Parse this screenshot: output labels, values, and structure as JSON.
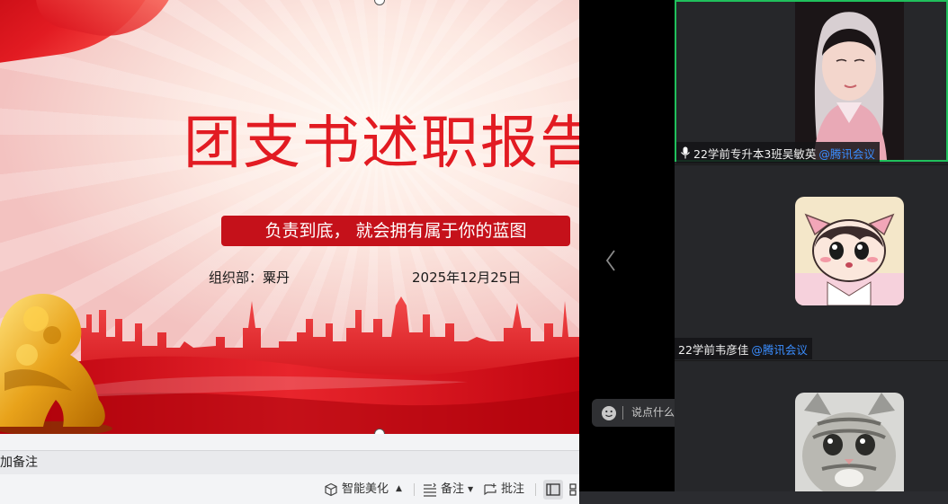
{
  "slide": {
    "title": "团支书述职报告",
    "subtitle": "负责到底， 就会拥有属于你的蓝图",
    "organizer": "组织部：粟丹",
    "date": "2025年12月25日"
  },
  "notes": {
    "placeholder": "添加备注"
  },
  "status_bar": {
    "smart_beautify": "智能美化",
    "notes": "备注",
    "annotate": "批注"
  },
  "chat": {
    "placeholder": "说点什么..."
  },
  "participants": [
    {
      "name": "22学前专升本3班吴敏英",
      "source": "@腾讯会议",
      "speaking": true
    },
    {
      "name": "22学前韦彦佳",
      "source": "@腾讯会议",
      "speaking": false
    }
  ],
  "colors": {
    "accent_red": "#e21b22",
    "active_speaker_border": "#20c05c",
    "meeting_link": "#3a8dff"
  }
}
